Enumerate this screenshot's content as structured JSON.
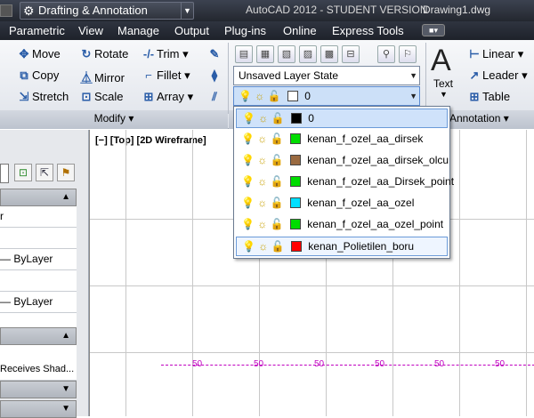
{
  "titlebar": {
    "workspace": "Drafting & Annotation",
    "app_title": "AutoCAD 2012 - STUDENT VERSION",
    "doc_title": "Drawing1.dwg"
  },
  "menu": {
    "items": [
      "Parametric",
      "View",
      "Manage",
      "Output",
      "Plug-ins",
      "Online",
      "Express Tools"
    ]
  },
  "modify": {
    "move": "Move",
    "rotate": "Rotate",
    "trim": "Trim",
    "copy": "Copy",
    "mirror": "Mirror",
    "fillet": "Fillet",
    "stretch": "Stretch",
    "scale": "Scale",
    "array": "Array",
    "panel_label": "Modify ▾"
  },
  "layers": {
    "state_combo": "Unsaved Layer State",
    "current_layer": "0"
  },
  "annotation": {
    "text": "Text",
    "linear": "Linear",
    "leader": "Leader",
    "table": "Table",
    "panel_label": "Annotation ▾"
  },
  "viewport": {
    "label": "[−] [Top] [2D Wireframe]",
    "dim_value": "50"
  },
  "left_panel": {
    "row1": "ByLayer",
    "row2": "ByLayer",
    "row3": "Receives Shad..."
  },
  "layer_list": [
    {
      "name": "0",
      "color": "#000000"
    },
    {
      "name": "kenan_f_ozel_aa_dirsek",
      "color": "#00dd00"
    },
    {
      "name": "kenan_f_ozel_aa_dirsek_olcu",
      "color": "#9a6a40"
    },
    {
      "name": "kenan_f_ozel_aa_Dirsek_point",
      "color": "#00dd00"
    },
    {
      "name": "kenan_f_ozel_aa_ozel",
      "color": "#00e0ff"
    },
    {
      "name": "kenan_f_ozel_aa_ozel_point",
      "color": "#00dd00"
    },
    {
      "name": "kenan_Polietilen_boru",
      "color": "#ff0000"
    }
  ]
}
